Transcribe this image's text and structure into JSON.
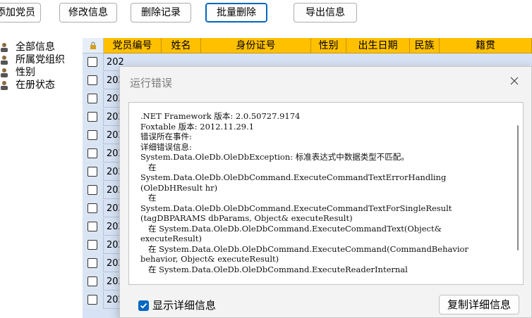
{
  "toolbar": {
    "buttons": [
      "添加党员",
      "修改信息",
      "删除记录",
      "批量删除",
      "导出信息"
    ]
  },
  "tree": {
    "items": [
      "全部信息",
      "所属党组织",
      "性别",
      "在册状态"
    ]
  },
  "grid": {
    "columns": [
      "党员编号",
      "姓名",
      "身份证号",
      "性别",
      "出生日期",
      "民族",
      "籍贯"
    ],
    "row_prefix": "202",
    "row_count": 14
  },
  "dialog": {
    "title": "运行错误",
    "detail": ".NET Framework 版本: 2.0.50727.9174\nFoxtable 版本: 2012.11.29.1\n错误所在事件:\n详细错误信息:\nSystem.Data.OleDb.OleDbException: 标准表达式中数据类型不匹配。\n   在\nSystem.Data.OleDb.OleDbCommand.ExecuteCommandTextErrorHandling\n(OleDbHResult hr)\n   在\nSystem.Data.OleDb.OleDbCommand.ExecuteCommandTextForSingleResult\n(tagDBPARAMS dbParams, Object& executeResult)\n   在 System.Data.OleDb.OleDbCommand.ExecuteCommandText(Object&\nexecuteResult)\n   在 System.Data.OleDb.OleDbCommand.ExecuteCommand(CommandBehavior\nbehavior, Object& executeResult)\n   在 System.Data.OleDb.OleDbCommand.ExecuteReaderInternal",
    "show_details_label": "显示详细信息",
    "show_details_checked": true,
    "copy_button_label": "复制详细信息"
  },
  "colors": {
    "header_bg": "#ffc000",
    "accent": "#0067c0",
    "grid_bg": "#d7e3f4"
  }
}
